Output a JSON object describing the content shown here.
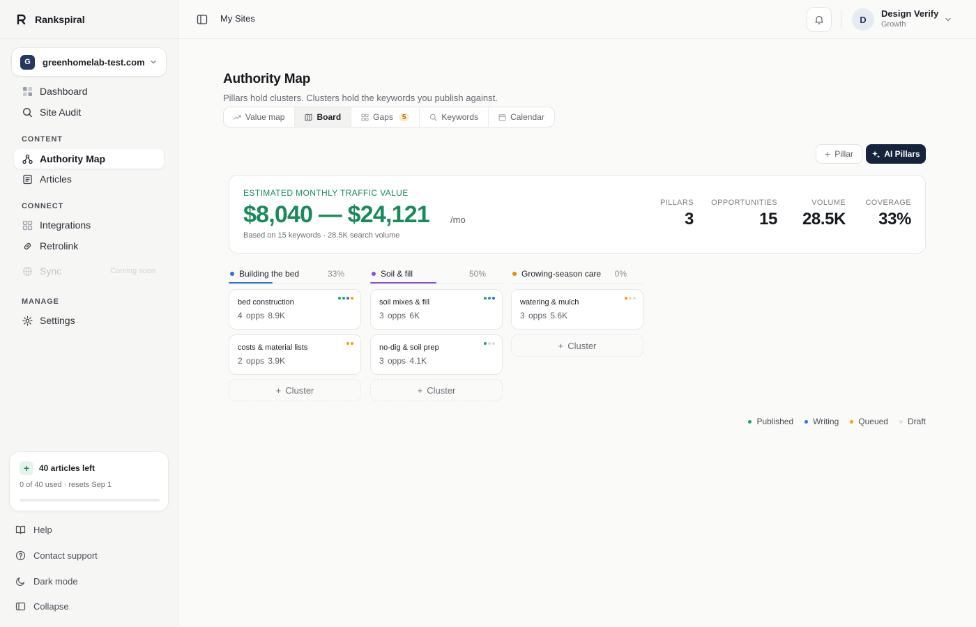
{
  "app": {
    "name": "Rankspiral"
  },
  "site": {
    "initial": "G",
    "domain": "greenhomelab-test.com"
  },
  "sidebar": {
    "items": [
      {
        "label": "Dashboard",
        "icon": "grid-icon"
      },
      {
        "label": "Site Audit",
        "icon": "search-icon"
      }
    ],
    "sections": {
      "content": "CONTENT",
      "connect": "CONNECT",
      "manage": "MANAGE"
    },
    "content_items": [
      {
        "label": "Authority Map",
        "icon": "network-icon",
        "active": true
      },
      {
        "label": "Articles",
        "icon": "document-icon"
      }
    ],
    "connect_items": [
      {
        "label": "Integrations",
        "icon": "apps-icon"
      },
      {
        "label": "Retrolink",
        "icon": "link-icon"
      },
      {
        "label": "Sync",
        "icon": "globe-icon",
        "badge": "Coming soon",
        "disabled": true
      }
    ],
    "manage_items": [
      {
        "label": "Settings",
        "icon": "gear-icon"
      }
    ],
    "credits": {
      "title": "40 articles left",
      "subtitle": "0 of 40 used · resets Sep 1",
      "used_fraction": 0
    },
    "footer": [
      {
        "label": "Help",
        "icon": "book-icon"
      },
      {
        "label": "Contact support",
        "icon": "help-circle-icon"
      },
      {
        "label": "Dark mode",
        "icon": "moon-icon"
      },
      {
        "label": "Collapse",
        "icon": "sidebar-icon"
      }
    ]
  },
  "topbar": {
    "breadcrumb": "My Sites",
    "user": {
      "initial": "D",
      "name": "Design Verify",
      "plan": "Growth"
    }
  },
  "main": {
    "title": "Authority Map",
    "subtitle": "Pillars hold clusters. Clusters hold the keywords you publish against.",
    "tabs": [
      {
        "label": "Value map",
        "icon": "trend-icon"
      },
      {
        "label": "Board",
        "icon": "board-icon",
        "active": true
      },
      {
        "label": "Gaps",
        "icon": "gaps-icon",
        "badge": "5"
      },
      {
        "label": "Keywords",
        "icon": "search-icon"
      },
      {
        "label": "Calendar",
        "icon": "calendar-icon"
      }
    ],
    "actions": {
      "pillar": "Pillar",
      "ai_pillars": "AI Pillars"
    },
    "value": {
      "label": "ESTIMATED MONTHLY TRAFFIC VALUE",
      "amount": "$8,040 — $24,121",
      "unit": "/mo",
      "basis": "Based on 15 keywords · 28.5K search volume"
    },
    "stats": [
      {
        "label": "PILLARS",
        "value": "3"
      },
      {
        "label": "OPPORTUNITIES",
        "value": "15"
      },
      {
        "label": "VOLUME",
        "value": "28.5K"
      },
      {
        "label": "COVERAGE",
        "value": "33%"
      }
    ],
    "pillars": [
      {
        "name": "Building the bed",
        "percent": "33%",
        "color": "#2f6fe0",
        "clusters": [
          {
            "name": "bed construction",
            "opps": "4 opps",
            "volume": "8.9K",
            "dots": [
              "#1aa36b",
              "#1aa36b",
              "#2f6fe0",
              "#f0a400"
            ]
          },
          {
            "name": "costs & material lists",
            "opps": "2 opps",
            "volume": "3.9K",
            "dots": [
              "#f0a400",
              "#f0a400"
            ]
          }
        ],
        "add_label": "Cluster"
      },
      {
        "name": "Soil & fill",
        "percent": "50%",
        "color": "#8a4fe0",
        "clusters": [
          {
            "name": "soil mixes & fill",
            "opps": "3 opps",
            "volume": "6K",
            "dots": [
              "#1aa36b",
              "#1aa36b",
              "#2f6fe0"
            ]
          },
          {
            "name": "no-dig & soil prep",
            "opps": "3 opps",
            "volume": "4.1K",
            "dots": [
              "#1aa36b",
              "#dcdcdc",
              "#dcdcdc"
            ]
          }
        ],
        "add_label": "Cluster"
      },
      {
        "name": "Growing-season care",
        "percent": "0%",
        "color": "#f08a00",
        "clusters": [
          {
            "name": "watering & mulch",
            "opps": "3 opps",
            "volume": "5.6K",
            "dots": [
              "#f0a400",
              "#f0dca0",
              "#dcdcdc"
            ]
          }
        ],
        "add_label": "Cluster"
      }
    ],
    "legend": [
      {
        "label": "Published",
        "color": "#1aa36b"
      },
      {
        "label": "Writing",
        "color": "#2f6fe0"
      },
      {
        "label": "Queued",
        "color": "#f0a400"
      },
      {
        "label": "Draft",
        "color": "#e2e2e0"
      }
    ]
  }
}
